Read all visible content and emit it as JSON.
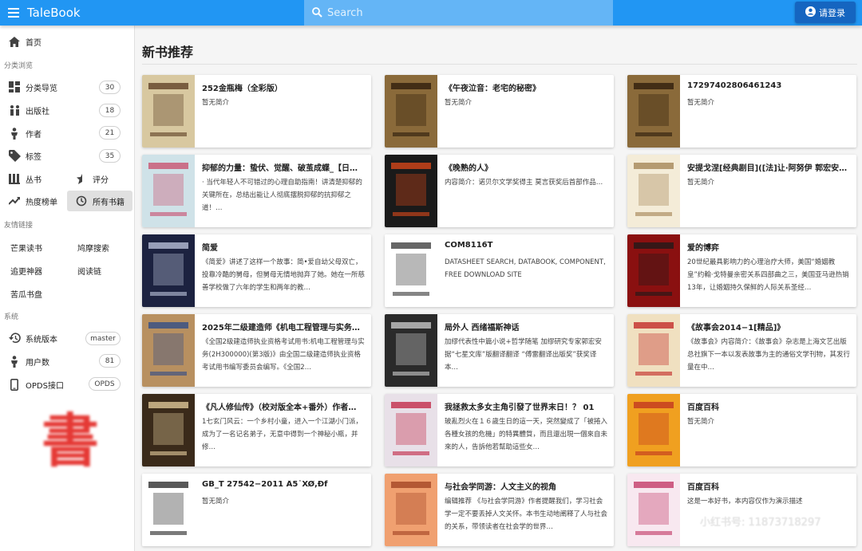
{
  "app": {
    "title": "TaleBook"
  },
  "search": {
    "placeholder": "Search"
  },
  "login": {
    "label": "请登录"
  },
  "sidebar": {
    "home": "首页",
    "section_browse": "分类浏览",
    "browse": [
      {
        "label": "分类导览",
        "count": "30",
        "icon": "dashboard-icon"
      },
      {
        "label": "出版社",
        "count": "18",
        "icon": "publisher-icon"
      },
      {
        "label": "作者",
        "count": "21",
        "icon": "person-icon"
      },
      {
        "label": "标签",
        "count": "35",
        "icon": "tag-icon"
      }
    ],
    "series": "丛书",
    "rating": "评分",
    "hot": "热度榜单",
    "all_books": "所有书籍",
    "section_links": "友情链接",
    "links": [
      "芒果读书",
      "鸠摩搜索",
      "追更神器",
      "阅读链",
      "苦瓜书盘"
    ],
    "section_system": "系统",
    "system": [
      {
        "label": "系统版本",
        "value": "master",
        "icon": "history-icon"
      },
      {
        "label": "用户数",
        "value": "81",
        "icon": "person-icon"
      },
      {
        "label": "OPDS接口",
        "value": "OPDS",
        "icon": "phone-icon"
      }
    ],
    "logo_text": "書"
  },
  "main": {
    "title": "新书推荐",
    "books": [
      {
        "title": "252金瓶梅（全彩版）",
        "desc": "暂无简介",
        "cover_bg": "#d8c8a0",
        "cover_fg": "#5a3a20"
      },
      {
        "title": "《午夜泣音：老宅的秘密》",
        "desc": "暂无简介",
        "cover_bg": "#8a6a3a",
        "cover_fg": "#2a1a0a"
      },
      {
        "title": "17297402806461243",
        "desc": "暂无简介",
        "cover_bg": "#8a6a3a",
        "cover_fg": "#2a1a0a"
      },
      {
        "title": "抑郁的力量：蛰伏、觉醒、破茧成蝶_【日…",
        "desc": "· 当代年轻人不可错过的心理自助指南！讲清楚抑郁的关键所在，总结出能让人彻底摆脱抑郁的抗抑郁之道！…",
        "cover_bg": "#cfe2e8",
        "cover_fg": "#c84a6a"
      },
      {
        "title": "《晚熟的人》",
        "desc": "内容简介：诺贝尔文学奖得主 莫言获奖后首部作品…",
        "cover_bg": "#1a1a1a",
        "cover_fg": "#e04a1a"
      },
      {
        "title": "安提戈涅[经典剧目]([法]让·阿努伊 郭宏安…",
        "desc": "暂无简介",
        "cover_bg": "#f4ecd8",
        "cover_fg": "#a08050"
      },
      {
        "title": "简爱",
        "desc": "《简爱》讲述了这样一个故事：简•爱自幼父母双亡，投靠冷酷的舅母，但舅母无情地抛弃了她。她在一所慈善学校做了六年的学生和两年的教…",
        "cover_bg": "#1c2240",
        "cover_fg": "#c0c8e0"
      },
      {
        "title": "COM8116T",
        "desc": "DATASHEET SEARCH, DATABOOK, COMPONENT, FREE DOWNLOAD SITE",
        "cover_bg": "#ffffff",
        "cover_fg": "#333333"
      },
      {
        "title": "爱的博弈",
        "desc": "20世纪最具影响力的心理治疗大师，美国“婚姻教皇”约翰·戈特曼亲密关系四部曲之三，美国亚马逊热销13年，让婚姻持久保鲜的人际关系圣经…",
        "cover_bg": "#8a1010",
        "cover_fg": "#1a1a1a"
      },
      {
        "title": "2025年二级建造师《机电工程管理与实务…",
        "desc": "《全国2级建造师执业资格考试用书:机电工程管理与实务(2H300000)(第3版)》由全国二级建造师执业资格考试用书编写委员会编写。《全国2…",
        "cover_bg": "#b89060",
        "cover_fg": "#2a4a8a"
      },
      {
        "title": "局外人 西绪福斯神话",
        "desc": "加缪代表性中篇小说+哲学随笔 加缪研究专家郭宏安据“七星文库”版翻译翻译 “傅雷翻译出版奖”获奖译本…",
        "cover_bg": "#2a2a2a",
        "cover_fg": "#d0d0d0"
      },
      {
        "title": "《故事会2014−1[精品]》",
        "desc": "《故事会》内容简介：《故事会》杂志是上海文艺出版总社旗下一本以发表故事为主的通俗文学刊物，其发行量在中…",
        "cover_bg": "#f0e0c0",
        "cover_fg": "#c02020"
      },
      {
        "title": "《凡人修仙传》（校对版全本+番外）作者…",
        "desc": "1七玄门风云：一个乡村小童，进入一个江湖小门派，成为了一名记名弟子，无意中得到一个神秘小瓶，并修…",
        "cover_bg": "#3a2a1a",
        "cover_fg": "#e8d0a0"
      },
      {
        "title": "我拯救太多女主角引發了世界末日！？ 01",
        "desc": "玻亂烈火在１６歲生日的這一天，突然變成了「被捲入各種女孩的危機」的特異體質，而且還出現一個來自未來的人，告訴他若幫助這些女…",
        "cover_bg": "#e8e0e8",
        "cover_fg": "#c02040"
      },
      {
        "title": "百度百科",
        "desc": "暂无简介",
        "cover_bg": "#f0a020",
        "cover_fg": "#c03020"
      },
      {
        "title": "GB_T 27542−2011 Â5˙XØ,Ðf",
        "desc": "暂无简介",
        "cover_bg": "#ffffff",
        "cover_fg": "#222222"
      },
      {
        "title": "与社会学同游：人文主义的视角",
        "desc": "编辑推荐 《与社会学同游》作者提醒我们，学习社会学一定不要丢掉人文关怀。本书生动地阐释了人与社会的关系，带领读者在社会学的世界…",
        "cover_bg": "#f0a070",
        "cover_fg": "#a04020"
      },
      {
        "title": "百度百科",
        "desc": "这是一本好书，本内容仅作为演示描述",
        "cover_bg": "#f8e8f0",
        "cover_fg": "#c03060"
      }
    ]
  },
  "watermark": "小红书号: 11873718297"
}
